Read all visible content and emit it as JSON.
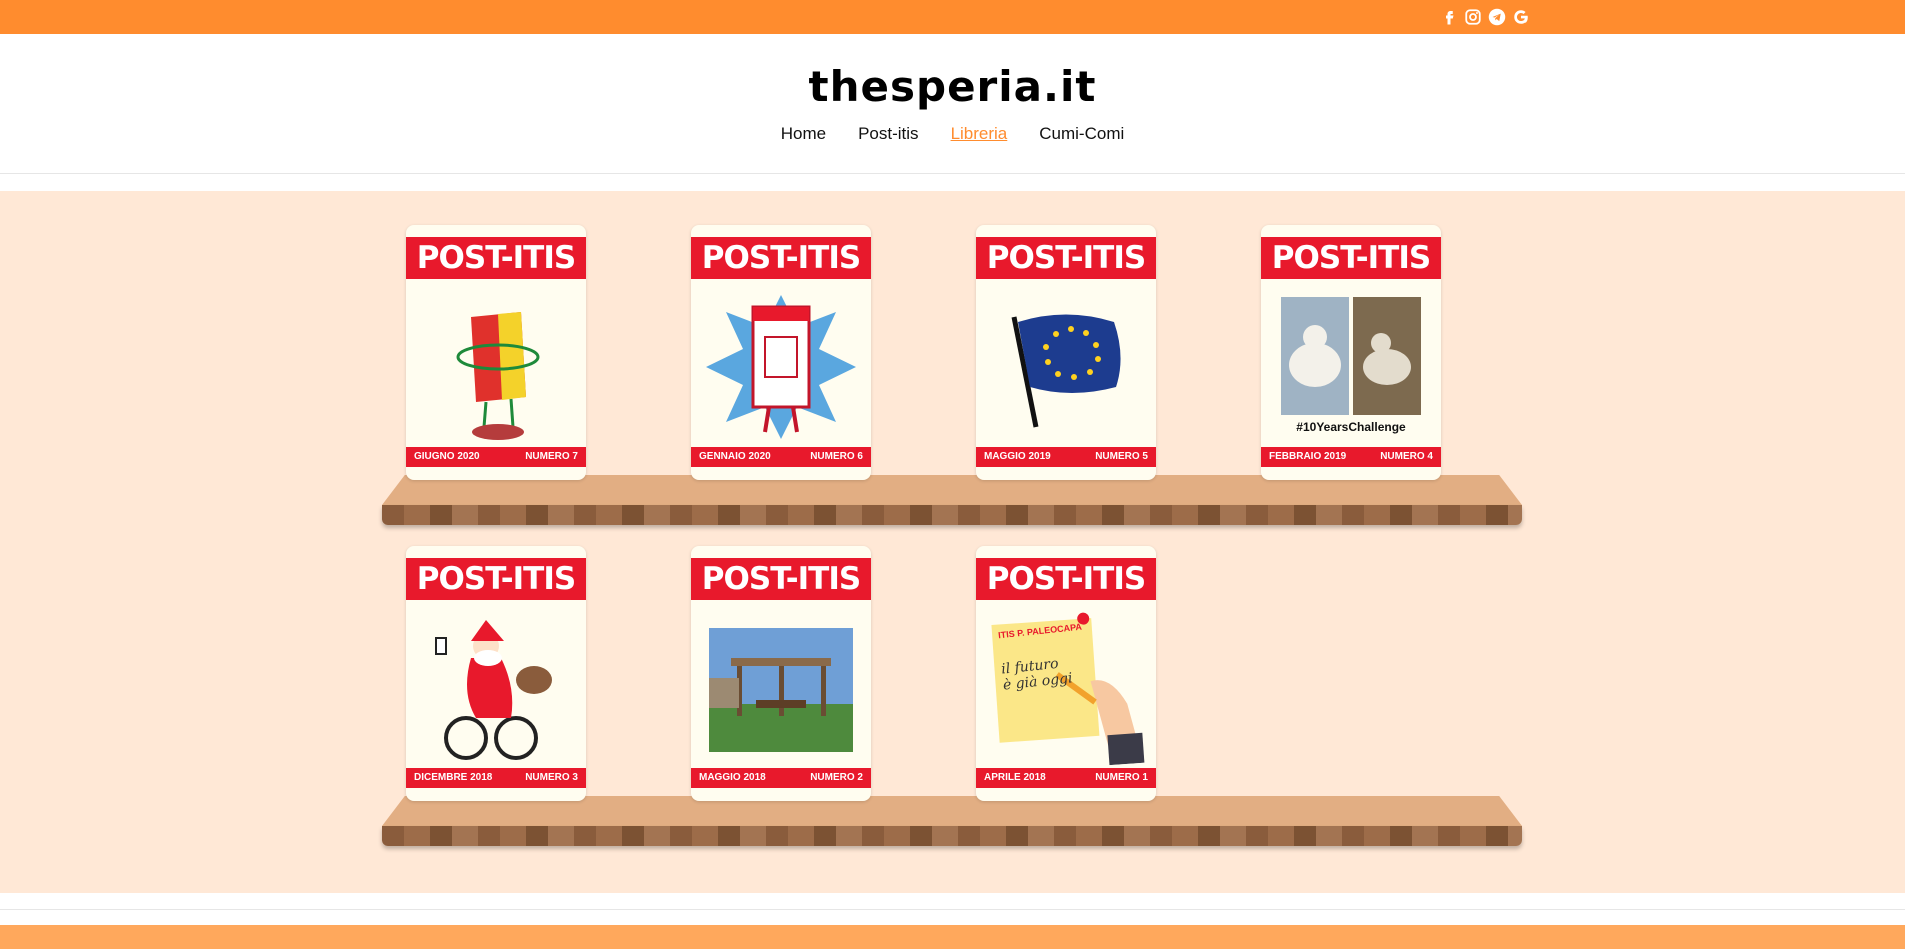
{
  "site": {
    "logo": "thesperia.it"
  },
  "social": [
    {
      "icon": "facebook-icon"
    },
    {
      "icon": "instagram-icon"
    },
    {
      "icon": "telegram-icon"
    },
    {
      "icon": "google-icon"
    }
  ],
  "nav": {
    "items": [
      {
        "label": "Home"
      },
      {
        "label": "Post-itis"
      },
      {
        "label": "Libreria"
      },
      {
        "label": "Cumi-Comi"
      }
    ],
    "active": "Libreria"
  },
  "colors": {
    "topbar": "#ff8c2e",
    "accent": "#ff8c2e",
    "library_bg": "#ffe8d6",
    "cover_red": "#e8192c"
  },
  "covers": [
    {
      "brand": "POST-ITIS",
      "date": "GIUGNO 2020",
      "issue": "NUMERO 7",
      "art": "coat-of-arms-icon"
    },
    {
      "brand": "POST-ITIS",
      "date": "GENNAIO 2020",
      "issue": "NUMERO 6",
      "art": "comic-burst-icon"
    },
    {
      "brand": "POST-ITIS",
      "date": "MAGGIO 2019",
      "issue": "NUMERO 5",
      "art": "eu-flag-icon"
    },
    {
      "brand": "POST-ITIS",
      "date": "FEBBRAIO 2019",
      "issue": "NUMERO 4",
      "art": "polar-bear-photo",
      "caption": "#10YearsChallenge"
    },
    {
      "brand": "POST-ITIS",
      "date": "DICEMBRE 2018",
      "issue": "NUMERO 3",
      "art": "santa-bike-icon"
    },
    {
      "brand": "POST-ITIS",
      "date": "MAGGIO 2018",
      "issue": "NUMERO 2",
      "art": "pergola-photo"
    },
    {
      "brand": "POST-ITIS",
      "date": "APRILE 2018",
      "issue": "NUMERO 1",
      "art": "sticky-note-icon",
      "note_title": "ITIS P. PALEOCAPA",
      "note_text": "il futuro è già oggi"
    }
  ]
}
